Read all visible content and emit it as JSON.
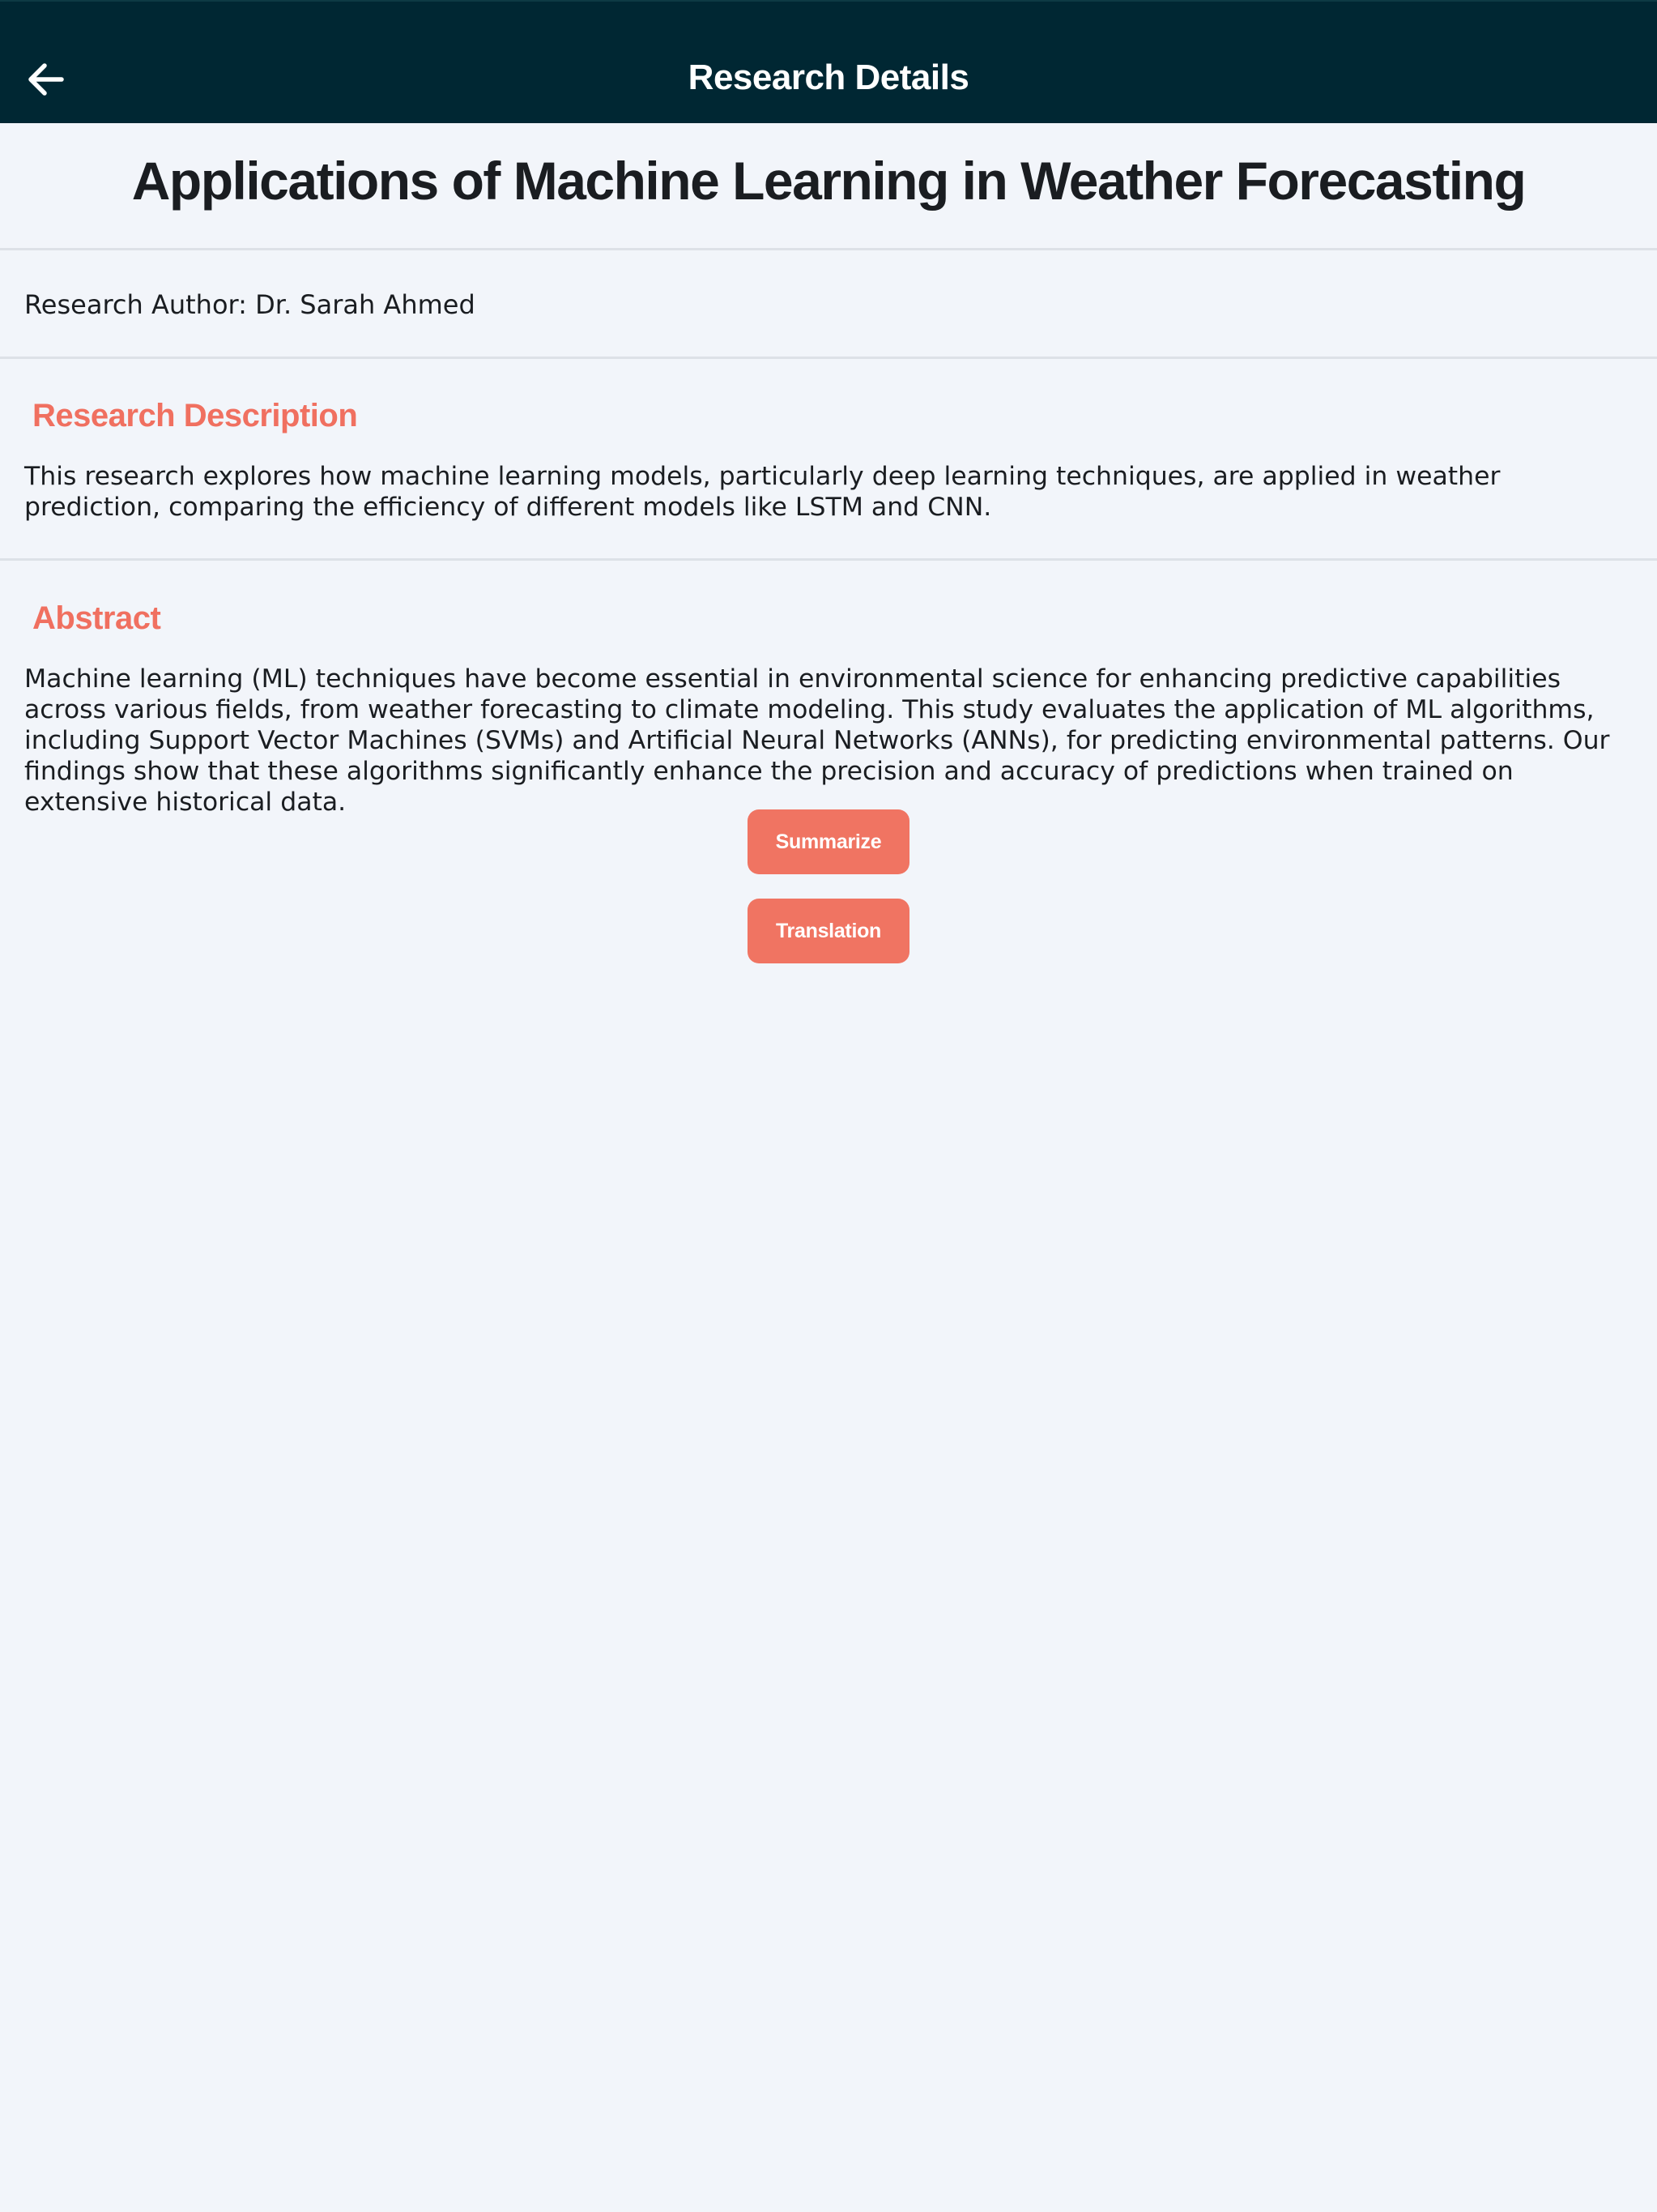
{
  "app_bar": {
    "title": "Research Details",
    "back_icon": "arrow-left-icon"
  },
  "research": {
    "title": "Applications of Machine Learning in Weather Forecasting",
    "author_line": "Research Author: Dr. Sarah Ahmed",
    "description_heading": "Research Description",
    "description": "This research explores how machine learning models, particularly deep learning techniques, are applied in weather prediction, comparing the efficiency of different models like LSTM and CNN.",
    "abstract_heading": "Abstract",
    "abstract": "Machine learning (ML) techniques have become essential in environmental science for enhancing predictive capabilities across various fields, from weather forecasting to climate modeling. This study evaluates the application of ML algorithms, including Support Vector Machines (SVMs) and Artificial Neural Networks (ANNs), for predicting environmental patterns. Our findings show that these algorithms significantly enhance the precision and accuracy of predictions when trained on extensive historical data."
  },
  "actions": {
    "summarize_label": "Summarize",
    "translation_label": "Translation"
  },
  "colors": {
    "app_bar_bg": "#002733",
    "accent": "#f07462",
    "background": "#f2f5fa",
    "text": "#1a1d21"
  }
}
